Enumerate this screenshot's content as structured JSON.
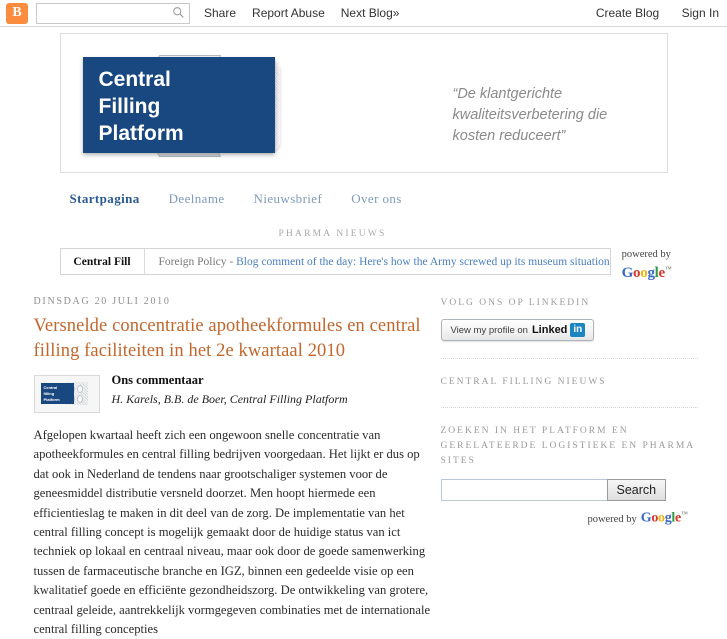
{
  "navbar": {
    "logo_letter": "B",
    "logo_icon": "blogger-b-icon",
    "search_placeholder": "",
    "search_value": "",
    "search_icon": "search-icon",
    "links": [
      {
        "label": "Share"
      },
      {
        "label": "Report Abuse"
      },
      {
        "label": "Next Blog»"
      }
    ],
    "right_links": [
      {
        "label": "Create Blog"
      },
      {
        "label": "Sign In"
      }
    ]
  },
  "header": {
    "logo_lines": [
      "Central",
      "Filling",
      "Platform"
    ],
    "logo_bg": "#18487f",
    "tagline": "“De klantgerichte kwaliteitsverbetering die kosten reduceert”"
  },
  "tabs": [
    {
      "label": "Startpagina",
      "active": true
    },
    {
      "label": "Deelname",
      "active": false
    },
    {
      "label": "Nieuwsbrief",
      "active": false
    },
    {
      "label": "Over ons",
      "active": false
    }
  ],
  "pharma": {
    "section_title": "PHARMA NIEUWS",
    "ticker_brand": "Central Fill",
    "ticker_source": "Foreign Policy -",
    "ticker_link": "Blog comment of the day: Here's how the Army screwed up its museum situation",
    "powered_by": "powered by",
    "google_letters": [
      "G",
      "o",
      "o",
      "g",
      "l",
      "e"
    ],
    "google_tm": "™"
  },
  "post": {
    "date": "DINSDAG 20 JULI 2010",
    "title": "Versnelde concentratie apotheekformules en central filling faciliteiten in het 2e kwartaal 2010",
    "title_color": "#c2662c",
    "thumb_lines": [
      "Central",
      "filling",
      "Platform"
    ],
    "byline_heading": "Ons commentaar",
    "byline_authors": "H. Karels, B.B. de Boer, Central Filling Platform",
    "body": "Afgelopen kwartaal heeft zich een ongewoon snelle concentratie van apotheekformules en central filling bedrijven voorgedaan. Het lijkt er dus op dat ook in Nederland de tendens naar grootschaliger systemen voor de geneesmiddel distributie versneld doorzet. Men hoopt hiermede een efficientieslag te maken in dit deel van de zorg. De implementatie van het central filling concept is mogelijk gemaakt door de huidige status van ict techniek op lokaal en centraal niveau, maar ook door de goede samenwerking tussen de farmaceutische branche en IGZ, binnen een gedeelde visie op een kwalitatief goede en efficiënte gezondheidszorg. De ontwikkeling van grotere, centraal geleide, aantrekkelijk vormgegeven combinaties met de internationale central filling concepties"
  },
  "sidebar": {
    "linkedin_heading": "VOLG ONS OP LINKEDIN",
    "linkedin_btn_prefix": "View my profile on",
    "linkedin_btn_word": "Linked",
    "linkedin_btn_badge": "in",
    "linkedin_badge_color": "#1a86c0",
    "nieuws_heading": "CENTRAL FILLING NIEUWS",
    "search_heading": "ZOEKEN IN HET PLATFORM EN GERELATEERDE LOGISTIEKE EN PHARMA SITES",
    "search_value": "",
    "search_placeholder": "",
    "search_button": "Search",
    "powered_by": "powered by",
    "google_letters": [
      "G",
      "o",
      "o",
      "g",
      "l",
      "e"
    ],
    "google_tm": "™"
  }
}
